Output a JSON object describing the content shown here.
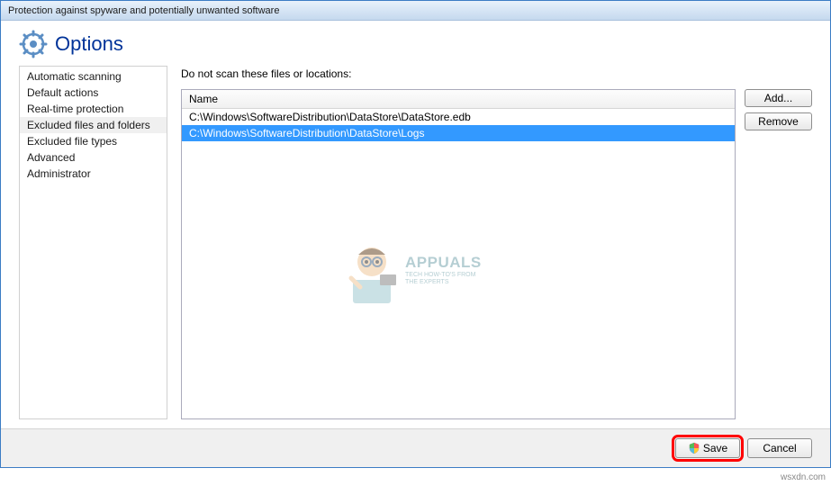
{
  "window": {
    "title": "Protection against spyware and potentially unwanted software"
  },
  "header": {
    "title": "Options"
  },
  "sidebar": {
    "items": [
      {
        "label": "Automatic scanning"
      },
      {
        "label": "Default actions"
      },
      {
        "label": "Real-time protection"
      },
      {
        "label": "Excluded files and folders"
      },
      {
        "label": "Excluded file types"
      },
      {
        "label": "Advanced"
      },
      {
        "label": "Administrator"
      }
    ],
    "selected_index": 3
  },
  "main": {
    "label": "Do not scan these files or locations:",
    "column_header": "Name",
    "items": [
      "C:\\Windows\\SoftwareDistribution\\DataStore\\DataStore.edb",
      "C:\\Windows\\SoftwareDistribution\\DataStore\\Logs"
    ],
    "selected_index": 1
  },
  "buttons": {
    "add": "Add...",
    "remove": "Remove",
    "save": "Save",
    "cancel": "Cancel"
  },
  "watermark": {
    "brand": "APPUALS",
    "tag1": "TECH HOW-TO'S FROM",
    "tag2": "THE EXPERTS"
  },
  "attribution": "wsxdn.com"
}
